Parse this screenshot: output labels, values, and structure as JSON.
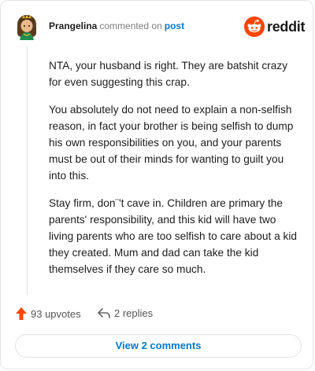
{
  "comment": {
    "username": "Prangelina",
    "meta_text": "commented on",
    "post_link": "post",
    "paragraphs": [
      "NTA, your husband is right. They are batshit crazy for even suggesting this crap.",
      "You absolutely do not need to explain a non-selfish reason, in fact your brother is being selfish to dump his own responsibilities on you, and your parents must be out of their minds for wanting to guilt you into this.",
      "Stay firm, don¨'t cave in. Children are primary the parents' responsibility, and this kid will have two living parents who are too selfish to care about a kid they created. Mum and dad can take the kid themselves if they care so much."
    ]
  },
  "brand": {
    "logo_text": "reddit",
    "logo_icon": "reddit-alien-icon",
    "accent": "#ff4500"
  },
  "actions": {
    "upvotes_label": "93 upvotes",
    "replies_label": "2 replies",
    "upvote_icon": "upvote-arrow-icon",
    "reply_icon": "reply-arrow-icon",
    "upvote_color": "#ff4500"
  },
  "footer": {
    "view_comments_label": "View 2 comments",
    "link_color": "#0079d3"
  }
}
